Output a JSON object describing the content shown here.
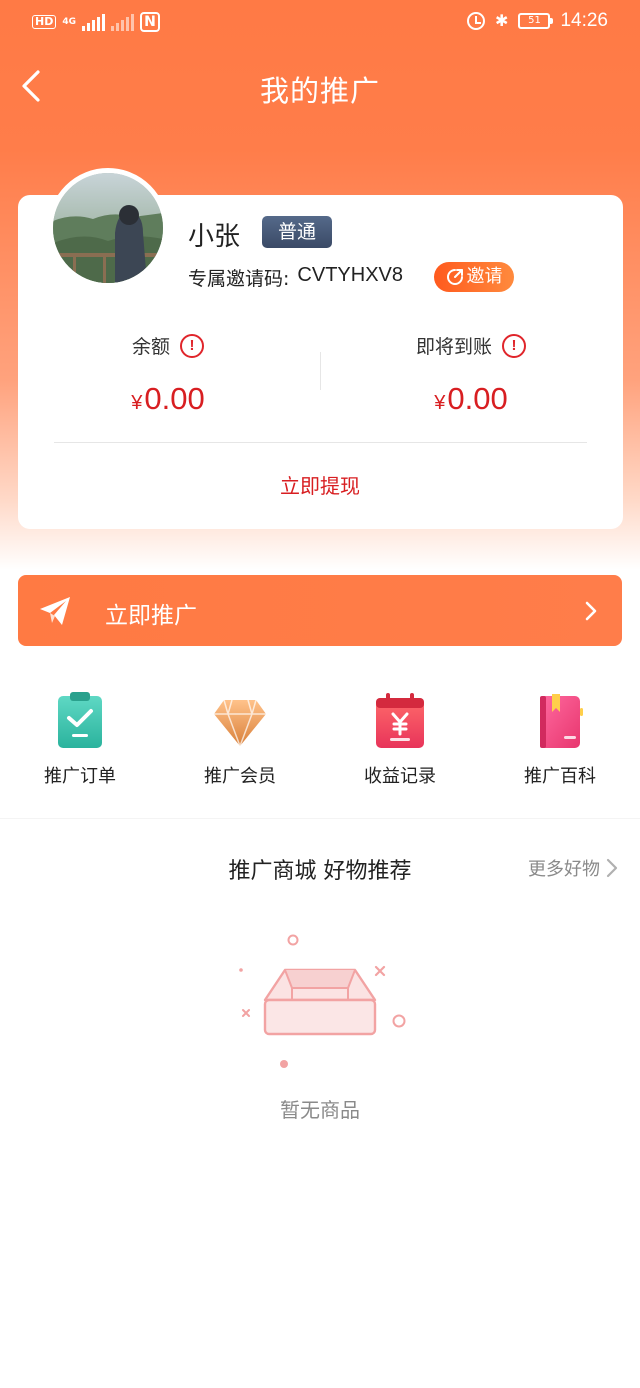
{
  "status_bar": {
    "left_badges": [
      "HD",
      "4G"
    ],
    "nfc": "N",
    "battery": "51",
    "time": "14:26",
    "icons": [
      "alarm-icon",
      "bluetooth-icon"
    ]
  },
  "nav": {
    "title": "我的推广",
    "back_icon": "chevron-left-icon"
  },
  "profile": {
    "name": "小张",
    "level": "普通",
    "invite_label": "专属邀请码:",
    "invite_code": "CVTYHXV8",
    "invite_button": "邀请",
    "balance": {
      "label": "余额",
      "currency": "¥",
      "amount": "0.00"
    },
    "pending": {
      "label": "即将到账",
      "currency": "¥",
      "amount": "0.00"
    },
    "withdraw_label": "立即提现"
  },
  "promote_bar": {
    "label": "立即推广",
    "icon": "paper-plane-icon"
  },
  "grid": [
    {
      "label": "推广订单",
      "icon": "clipboard-check-icon"
    },
    {
      "label": "推广会员",
      "icon": "diamond-icon"
    },
    {
      "label": "收益记录",
      "icon": "yen-calendar-icon"
    },
    {
      "label": "推广百科",
      "icon": "book-icon"
    }
  ],
  "mall": {
    "title": "推广商城 好物推荐",
    "more_label": "更多好物",
    "empty_text": "暂无商品"
  },
  "colors": {
    "brand_orange": "#ff7a45",
    "price_red": "#d81e21",
    "badge_navy": "#3a4a66"
  }
}
